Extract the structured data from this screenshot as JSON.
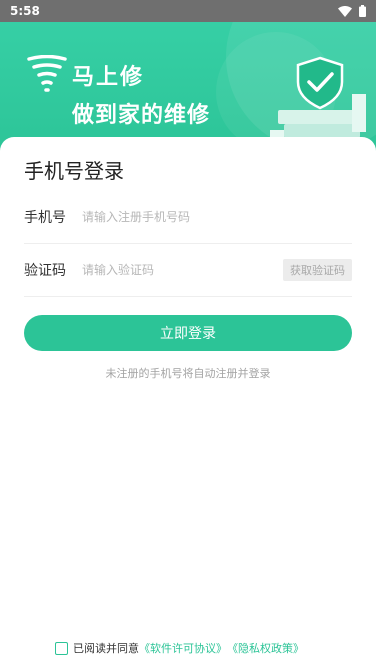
{
  "status_bar": {
    "time": "5:58",
    "icons": [
      "wifi-icon",
      "battery-icon"
    ]
  },
  "hero": {
    "brand": "马上修",
    "slogan": "做到家的维修"
  },
  "login": {
    "title": "手机号登录",
    "phone_label": "手机号",
    "phone_placeholder": "请输入注册手机号码",
    "code_label": "验证码",
    "code_placeholder": "请输入验证码",
    "get_code_label": "获取验证码",
    "submit_label": "立即登录",
    "hint": "未注册的手机号将自动注册并登录"
  },
  "agreement": {
    "prefix": "已阅读并同意",
    "software_link": "《软件许可协议》",
    "privacy_link": "《隐私权政策》"
  },
  "colors": {
    "accent": "#2cc497",
    "status_bar": "#6f6f6f"
  }
}
